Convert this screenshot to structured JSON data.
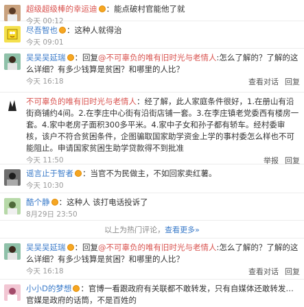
{
  "comments": [
    {
      "user": "超级超级棒的幸运迪",
      "has_badge": true,
      "sep": "：",
      "text": "能点破村官能他了就",
      "time": "今天 00:12"
    },
    {
      "user": "尽吾智也",
      "has_badge": true,
      "sep": "：",
      "text": "这种人就得治",
      "time": "今天 09:01"
    },
    {
      "user": "吴吴吴延瑞",
      "has_badge": true,
      "sep": "：回复",
      "mention": "@不可辜负的唯有旧时光与老情人",
      "text": ":怎么了解的？了解的这么详细？有多少钱算是贫困？和哪里的人比？",
      "time": "今天 16:18",
      "actions": [
        "查看对话",
        "回复"
      ]
    },
    {
      "user": "不可辜负的唯有旧时光与老情人",
      "has_badge": false,
      "sep": "：",
      "text": "经了解，此人家庭条件很好，1.在册山有沿街商铺约4间。2.在李庄中心街有沿街店铺一套。3.在李庄镇老党委西有楼房一套。4.家中老房子面积300多平米。4.家中子女和孙子都有轿车。经村委审核，该户不符合贫困条件，企图骗取国家助学资金上学的事村委怎么样也不可能阻止。申请国家贫困生助学贷款得不到批准",
      "time": "今天 11:50",
      "actions": [
        "举报",
        "回复"
      ]
    },
    {
      "user": "谣言止于智者",
      "has_badge": true,
      "sep": "：",
      "text": "当官不为民做主，不如回家卖红薯。",
      "time": "今天 10:30"
    },
    {
      "user": "酷个静",
      "has_badge": true,
      "sep": "：",
      "text": "这种人 该打电话投诉了",
      "time": "8月29日 23:50"
    }
  ],
  "hot_divider": {
    "text": "以上为热门评论，",
    "more": "查看更多»"
  },
  "comments_after": [
    {
      "user": "吴吴吴延瑞",
      "has_badge": true,
      "sep": "：回复",
      "mention": "@不可辜负的唯有旧时光与老情人",
      "text": ":怎么了解的？了解的这么详细？有多少钱算是贫困？和哪里的人比？",
      "time": "今天 16:18",
      "actions": [
        "查看对话",
        "回复"
      ]
    },
    {
      "user": "小小D的梦想",
      "has_badge": true,
      "sep": "：",
      "text": "官博一看跟政府有关联都不敢转发，只有自媒体还敢转发…官媒是政府的话筒，不是百姓的",
      "time": ""
    }
  ]
}
